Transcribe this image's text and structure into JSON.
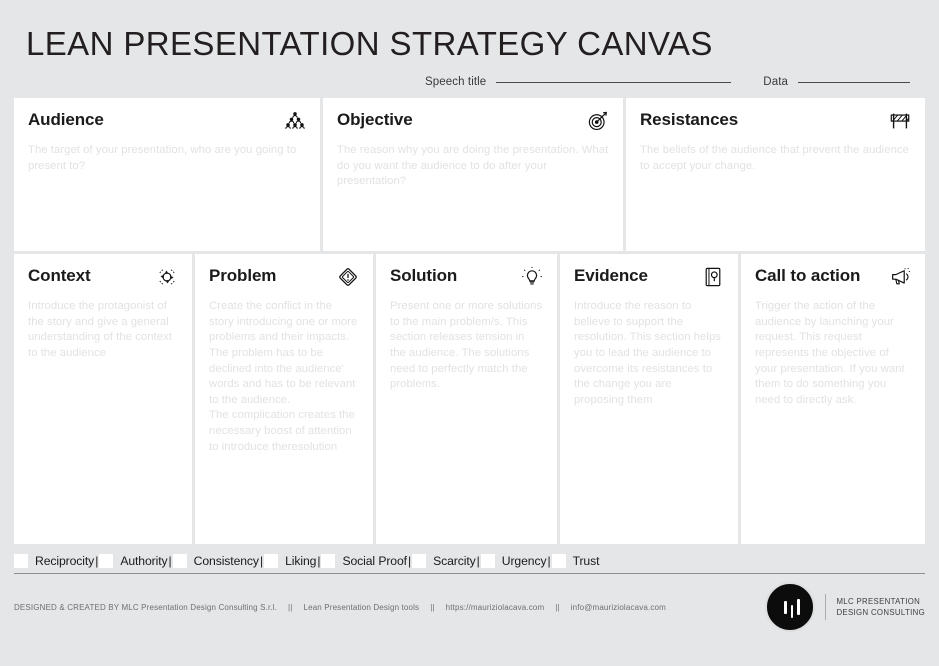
{
  "header": {
    "title": "LEAN PRESENTATION STRATEGY CANVAS",
    "speech_title_label": "Speech title",
    "data_label": "Data"
  },
  "cards": {
    "top": [
      {
        "title": "Audience",
        "icon": "crowd-icon",
        "placeholder": "The target of your presentation, who are you going to present to?"
      },
      {
        "title": "Objective",
        "icon": "target-arrow-icon",
        "placeholder": "The reason why you are doing the presentation. What do you want the audience to do after your presentation?"
      },
      {
        "title": "Resistances",
        "icon": "barricade-icon",
        "placeholder": "The beliefs of the audience that prevent the audience to accept your change."
      }
    ],
    "bottom": [
      {
        "title": "Context",
        "icon": "compass-rotation-icon",
        "placeholder": "Introduce the protagonist of the story and give a general understanding of the context to the audience"
      },
      {
        "title": "Problem",
        "icon": "warning-diamond-icon",
        "placeholder": "Create the conflict in the story introducing one or more problems and their impacts.\nThe problem has to be declined into the audience' words and has to be relevant to the audience.\nThe complication creates the necessary boost of attention to introduce theresolution"
      },
      {
        "title": "Solution",
        "icon": "lightbulb-icon",
        "placeholder": "Present one or more solutions to the main problem/s. This section releases tension in the audience. The solutions need to perfectly match the problems."
      },
      {
        "title": "Evidence",
        "icon": "document-search-icon",
        "placeholder": "Introduce the reason to believe to support the resolution. This section helps you to lead the audience to overcome its resistances to the change you are proposing them"
      },
      {
        "title": "Call to action",
        "icon": "megaphone-icon",
        "placeholder": "Trigger the action of the audience by launching your request. This request represents the objective of your presentation. If you want them to do something you need to directly ask."
      }
    ]
  },
  "principles": [
    {
      "label": "Reciprocity",
      "checked": false
    },
    {
      "label": "Authority",
      "checked": false
    },
    {
      "label": "Consistency",
      "checked": false
    },
    {
      "label": "Liking",
      "checked": false
    },
    {
      "label": "Social Proof",
      "checked": false
    },
    {
      "label": "Scarcity",
      "checked": false
    },
    {
      "label": "Urgency",
      "checked": false
    },
    {
      "label": "Trust",
      "checked": false
    }
  ],
  "footer": {
    "credits": [
      "DESIGNED & CREATED BY MLC Presentation Design Consulting S.r.l.",
      "Lean Presentation Design tools",
      "https://mauriziolacava.com",
      "info@mauriziolacava.com"
    ],
    "separator": "||",
    "brand_line1": "MLC PRESENTATION",
    "brand_line2": "DESIGN CONSULTING"
  },
  "colors": {
    "background": "#e4e6e7",
    "card": "#ffffff",
    "title": "#231f20",
    "placeholder": "#e2e2e2",
    "footer_text": "#6d7072",
    "brand_mark": "#0c0c0c"
  }
}
